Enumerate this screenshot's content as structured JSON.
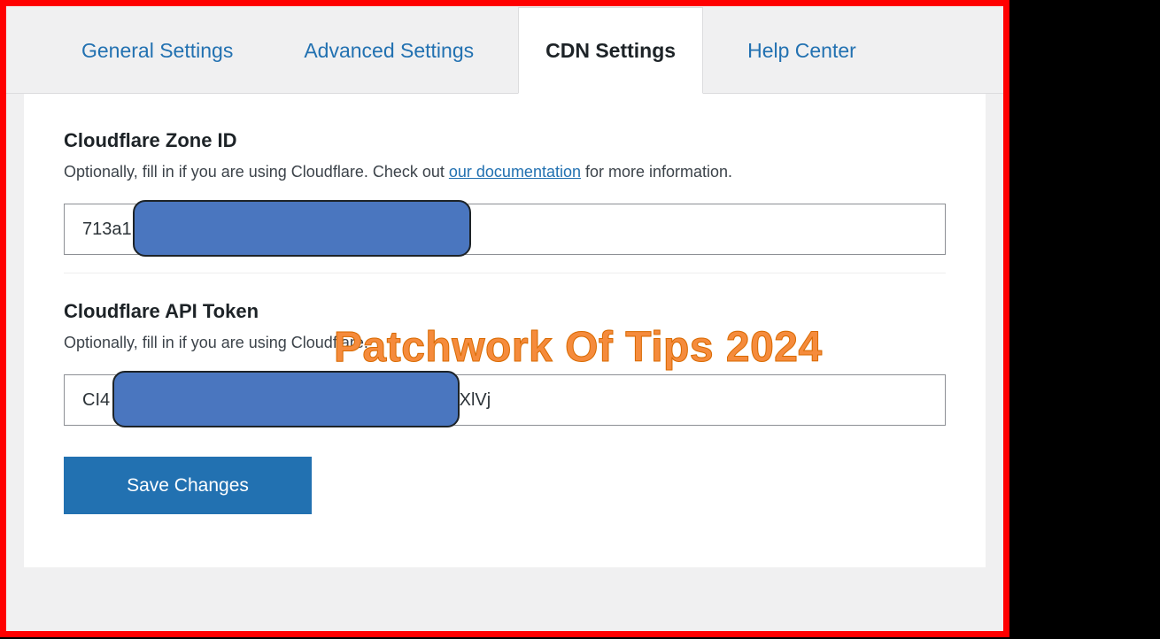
{
  "tabs": {
    "general": "General Settings",
    "advanced": "Advanced Settings",
    "cdn": "CDN Settings",
    "help": "Help Center"
  },
  "zone": {
    "heading": "Cloudflare Zone ID",
    "desc_pre": "Optionally, fill in if you are using Cloudflare. Check out ",
    "desc_link": "our documentation",
    "desc_post": " for more information.",
    "value": "713a1"
  },
  "token": {
    "heading": "Cloudflare API Token",
    "desc": "Optionally, fill in if you are using Cloudflare.",
    "value": "CI4                                                                    mXlVj"
  },
  "save_label": "Save Changes",
  "watermark": "Patchwork Of Tips 2024"
}
